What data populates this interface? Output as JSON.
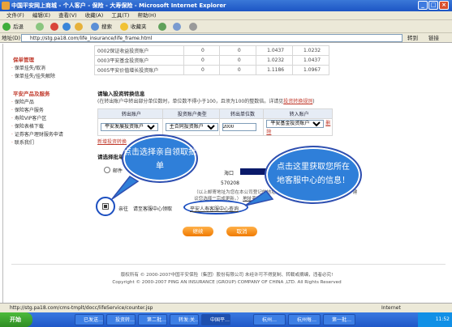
{
  "window": {
    "title": "中国平安网上商城 - 个人客户 - 保险 - 大寿保险 - Microsoft Internet Explorer"
  },
  "menu": [
    "文件(F)",
    "编辑(E)",
    "查看(V)",
    "收藏(A)",
    "工具(T)",
    "帮助(H)"
  ],
  "toolbar": {
    "back": "后退",
    "search": "搜索",
    "favorites": "收藏夹"
  },
  "address": {
    "label": "地址(D)",
    "url": "http://stg.pa18.com/life_insurance/life_frame.html",
    "go": "转到",
    "links": "链接"
  },
  "sidebar": {
    "sections": [
      {
        "title": "保单管理",
        "items": [
          "保单挂失/取消",
          "保单挂失/挂失解除"
        ]
      },
      {
        "title": "平安产品及服务",
        "items": [
          "保险产品",
          "保险客户服务",
          "寿险VIP客户区",
          "保险表格下载",
          "证券客户理财服务申请",
          "联系我们"
        ]
      }
    ]
  },
  "accounts": [
    {
      "name": "0002保证收益投资账户",
      "a": "0",
      "b": "0",
      "c": "1.0437",
      "d": "1.0232"
    },
    {
      "name": "0003平安基金投资账户",
      "a": "0",
      "b": "0",
      "c": "1.0232",
      "d": "1.0437"
    },
    {
      "name": "0005平安价值增长投资账户",
      "a": "0",
      "b": "0",
      "c": "1.1186",
      "d": "1.0967"
    }
  ],
  "transfer": {
    "title": "请输入投资转换信息",
    "note": "(在转出账户中转出部分单位数时，单位数不得小于100，且须为100的整数倍。详请见",
    "note_link": "投资转换规则",
    "note_end": ")",
    "headers": [
      "转出账户",
      "投资账户类型",
      "转出单位数",
      "转入账户"
    ],
    "row": {
      "out": "平安发展投资账户",
      "type": "主合同投资账户",
      "units": "2000",
      "in": "平安基金投资账户",
      "del": "删除"
    },
    "add_link": "新增投资转换"
  },
  "method": {
    "title": "请选择批单",
    "mail_label": "邮件",
    "addr1": "海口",
    "zip": "570208",
    "note": "（以上邮寄地址为您在本公司登记的地址，如需更改，如果您已更换了新地址，建议您选择\"\"完成更新。）",
    "update_link": "地址变更",
    "self_label": "亲往",
    "self_text": "请至客服中心领取",
    "self_link": "平安人寿客服中心查询"
  },
  "buttons": {
    "continue": "继续",
    "cancel": "取消"
  },
  "callouts": {
    "left": "点击选择亲自领取批单",
    "right": "点击这里获取您所在地客服中心的信息！"
  },
  "footer": {
    "cn": "版权所有 © 2000-2007中国平安保险（集团）股份有限公司 未经许可不得复制、转载或摘编，违者必究!",
    "en": "Copyright © 2000-2007 PING AN INSURANCE (GROUP) COMPANY OF CHINA ,LTD. All Rights Reserved"
  },
  "status": {
    "url": "http://stg.pa18.com/cms-tmplt/docc/lifeService/counter.jsp",
    "zone": "Internet"
  },
  "taskbar": {
    "start": "开始",
    "tasks": [
      "已发送…",
      "投资转…",
      "第二批…",
      "转发:关…",
      "中国平…",
      "杭州…",
      "杭州每…",
      "第一批…"
    ],
    "clock": "11:52"
  }
}
